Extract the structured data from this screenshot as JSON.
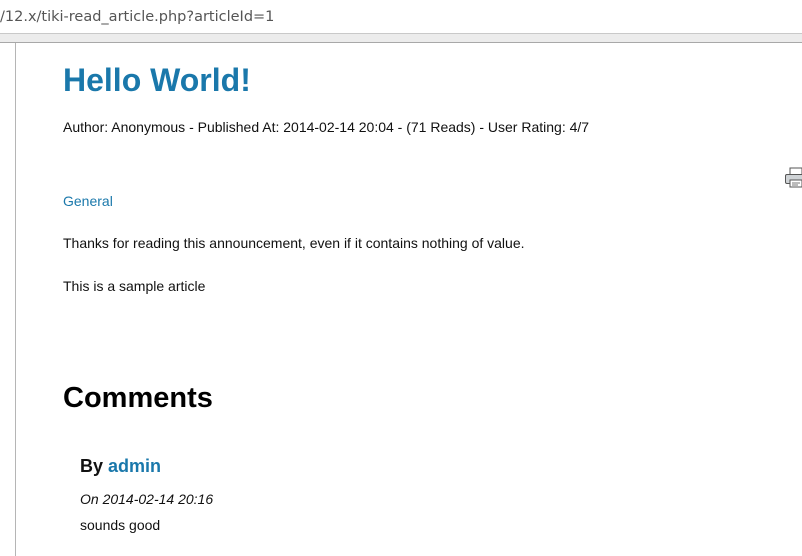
{
  "browser": {
    "url": "/12.x/tiki-read_article.php?articleId=1"
  },
  "article": {
    "title": "Hello World!",
    "meta": "Author: Anonymous - Published At: 2014-02-14 20:04 - (71 Reads) - User Rating: 4/7",
    "topic": "General",
    "body": [
      "Thanks for reading this announcement, even if it contains nothing of value.",
      "This is a sample article"
    ],
    "print_icon": "printer-icon"
  },
  "comments": {
    "heading": "Comments",
    "items": [
      {
        "by_label": "By",
        "author": "admin",
        "date": "On 2014-02-14 20:16",
        "text": "sounds good"
      }
    ]
  }
}
